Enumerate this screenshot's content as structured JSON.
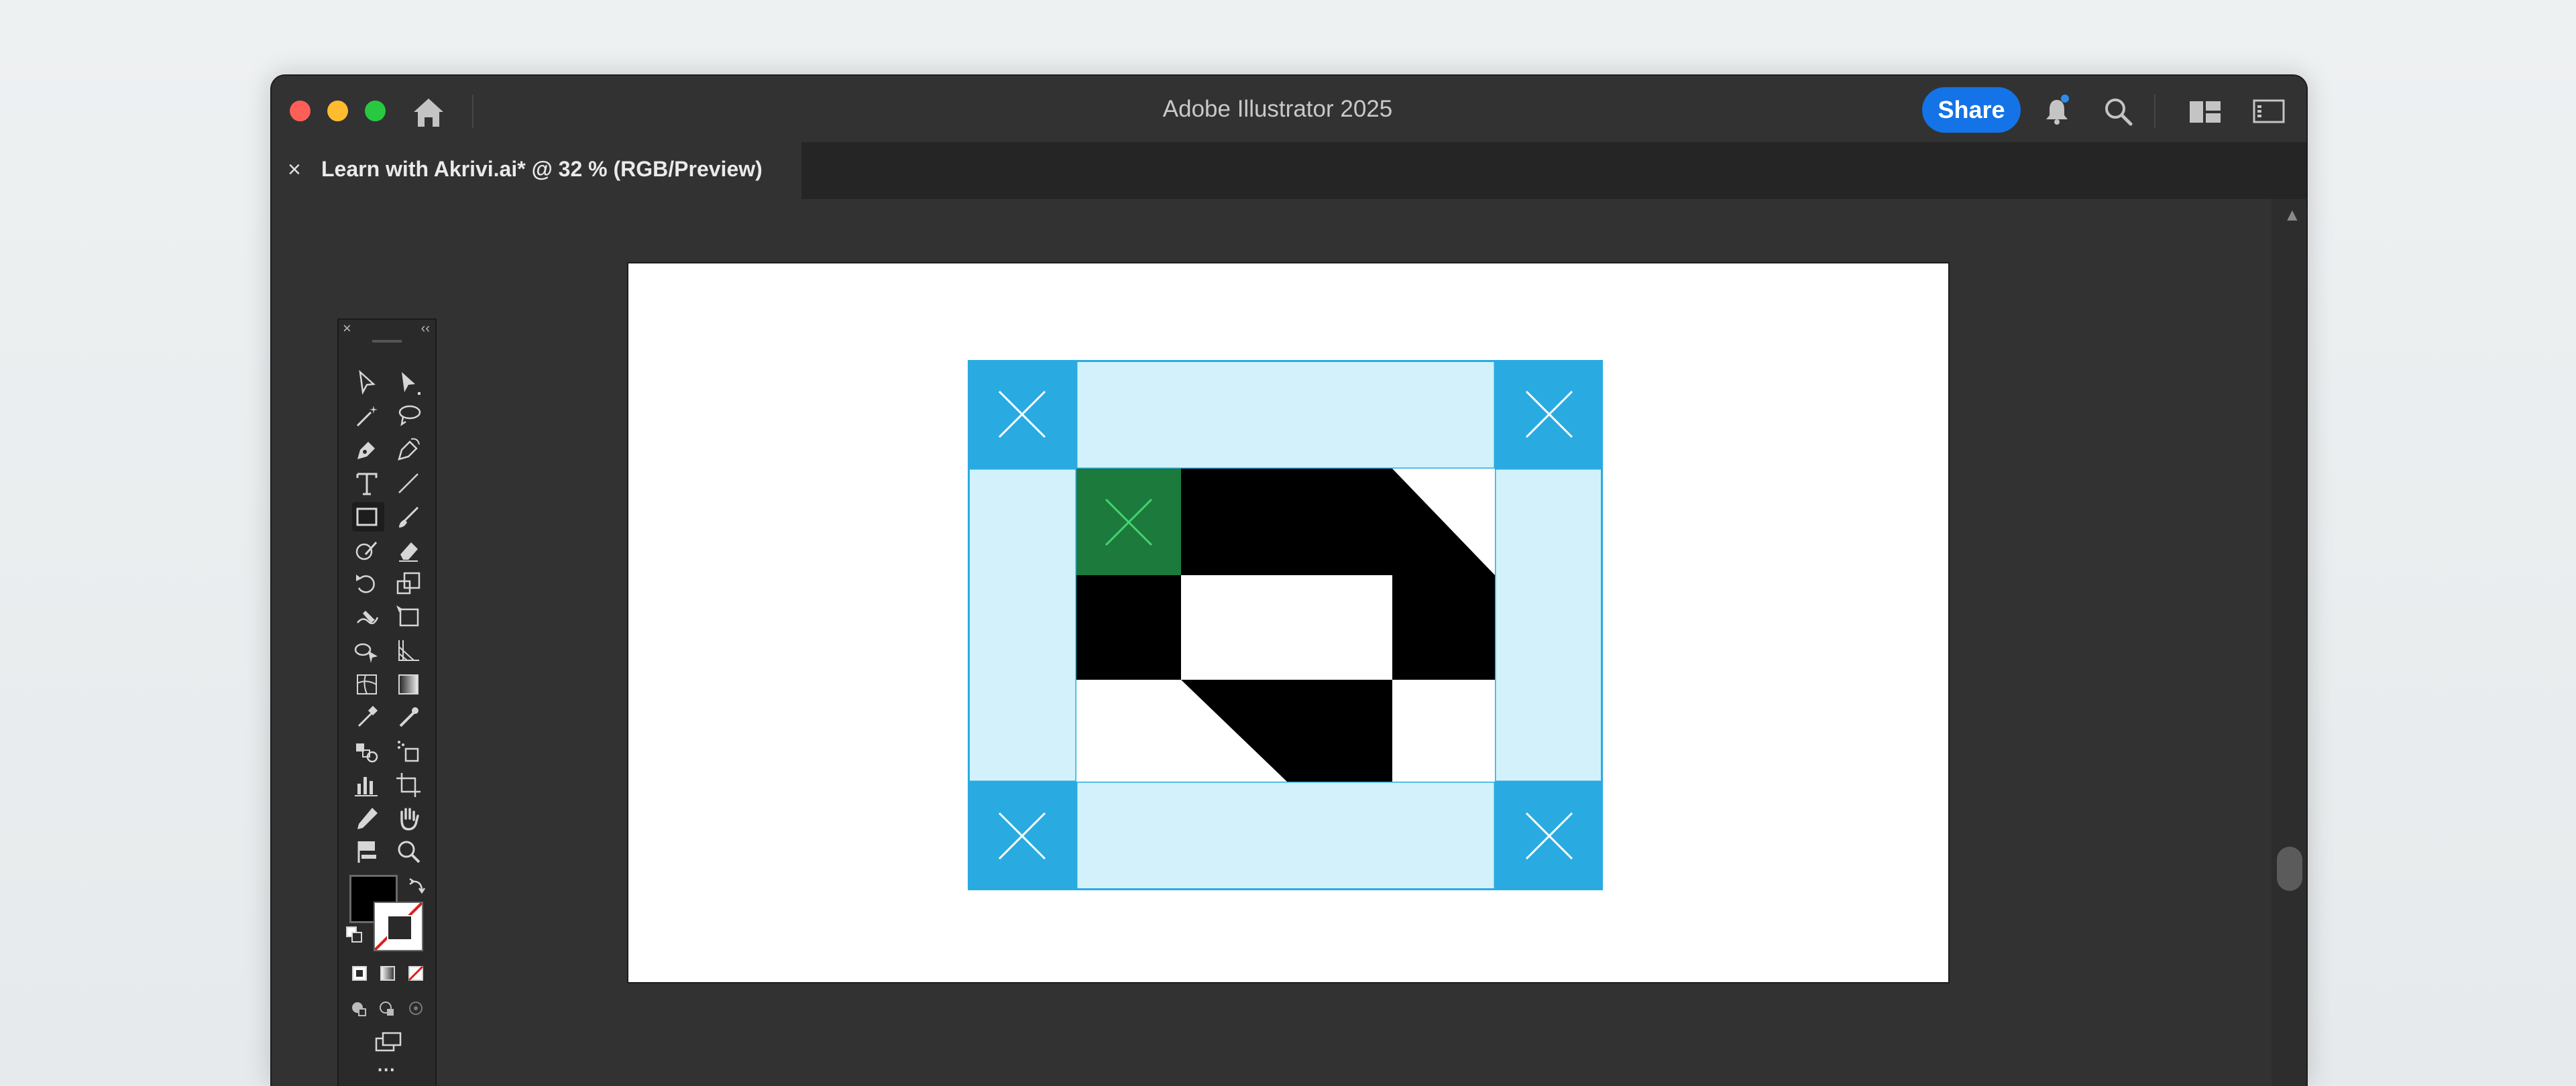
{
  "window": {
    "app_title": "Adobe Illustrator 2025",
    "share_label": "Share"
  },
  "titlebar_icons": [
    "home-icon",
    "bell-icon",
    "search-icon",
    "workspace-switcher-icon",
    "panel-toggle-icon"
  ],
  "document_tab": {
    "close_glyph": "×",
    "title": "Learn with Akrivi.ai* @ 32 % (RGB/Preview)"
  },
  "toolbar": {
    "more_glyph": "...",
    "tools": [
      "selection-tool",
      "direct-selection-tool",
      "magic-wand-tool",
      "lasso-tool",
      "pen-tool",
      "curvature-tool",
      "type-tool",
      "line-segment-tool",
      "rectangle-tool",
      "paintbrush-tool",
      "shaper-tool",
      "eraser-tool",
      "rotate-tool",
      "scale-tool",
      "warp-tool",
      "free-transform-tool",
      "shape-builder-tool",
      "perspective-grid-tool",
      "mesh-tool",
      "gradient-tool",
      "eyedropper-tool",
      "measure-tool",
      "blend-tool",
      "symbol-sprayer-tool",
      "column-graph-tool",
      "artboard-tool",
      "slice-tool",
      "hand-tool",
      "print-tiling-tool",
      "zoom-tool"
    ]
  },
  "colors": {
    "nine_slice_corner": "#29abe2",
    "nine_slice_edge": "#d2f1fb",
    "highlight_cell": "#1c7a3c",
    "accent": "#1473e6"
  }
}
